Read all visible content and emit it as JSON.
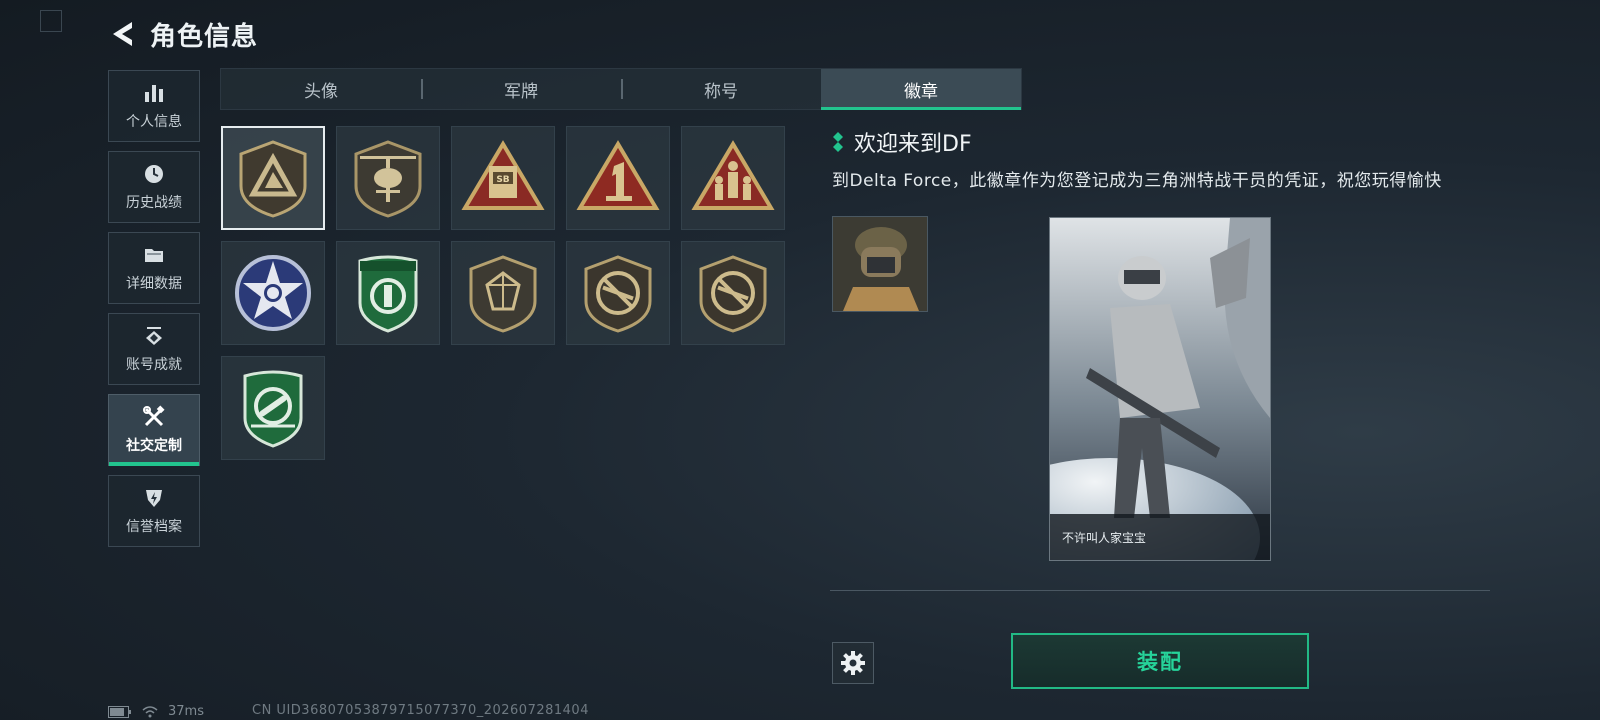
{
  "header": {
    "title": "角色信息"
  },
  "sidebar": {
    "items": [
      {
        "label": "个人信息",
        "icon": "bar-chart-icon"
      },
      {
        "label": "历史战绩",
        "icon": "clock-icon"
      },
      {
        "label": "详细数据",
        "icon": "folder-icon"
      },
      {
        "label": "账号成就",
        "icon": "achievement-icon"
      },
      {
        "label": "社交定制",
        "icon": "tools-icon",
        "active": true
      },
      {
        "label": "信誉档案",
        "icon": "shield-bolt-icon"
      }
    ]
  },
  "tabs": [
    {
      "label": "头像"
    },
    {
      "label": "军牌"
    },
    {
      "label": "称号"
    },
    {
      "label": "徽章",
      "active": true
    }
  ],
  "badges": [
    {
      "icon": "delta-shield-badge-icon",
      "selected": true
    },
    {
      "icon": "helicopter-badge-icon"
    },
    {
      "icon": "sb-vehicle-badge-icon"
    },
    {
      "icon": "number-one-badge-icon"
    },
    {
      "icon": "soldiers-badge-icon"
    },
    {
      "icon": "skull-star-badge-icon"
    },
    {
      "icon": "green-emblem-badge-icon"
    },
    {
      "icon": "gem-shield-badge-icon"
    },
    {
      "icon": "no-rifle-badge-icon"
    },
    {
      "icon": "no-rifle-badge-icon-2"
    },
    {
      "icon": "green-ordnance-badge-icon"
    }
  ],
  "detail": {
    "name": "欢迎来到DF",
    "description": "到Delta Force，此徽章作为您登记成为三角洲特战干员的凭证，祝您玩得愉快",
    "card_caption": "不许叫人家宝宝",
    "equip_label": "装配"
  },
  "status_bar": {
    "ping": "37ms",
    "uid": "CN UID36807053879715077370_202607281404"
  },
  "colors": {
    "accent": "#22c48e",
    "background": "#1d2731"
  }
}
